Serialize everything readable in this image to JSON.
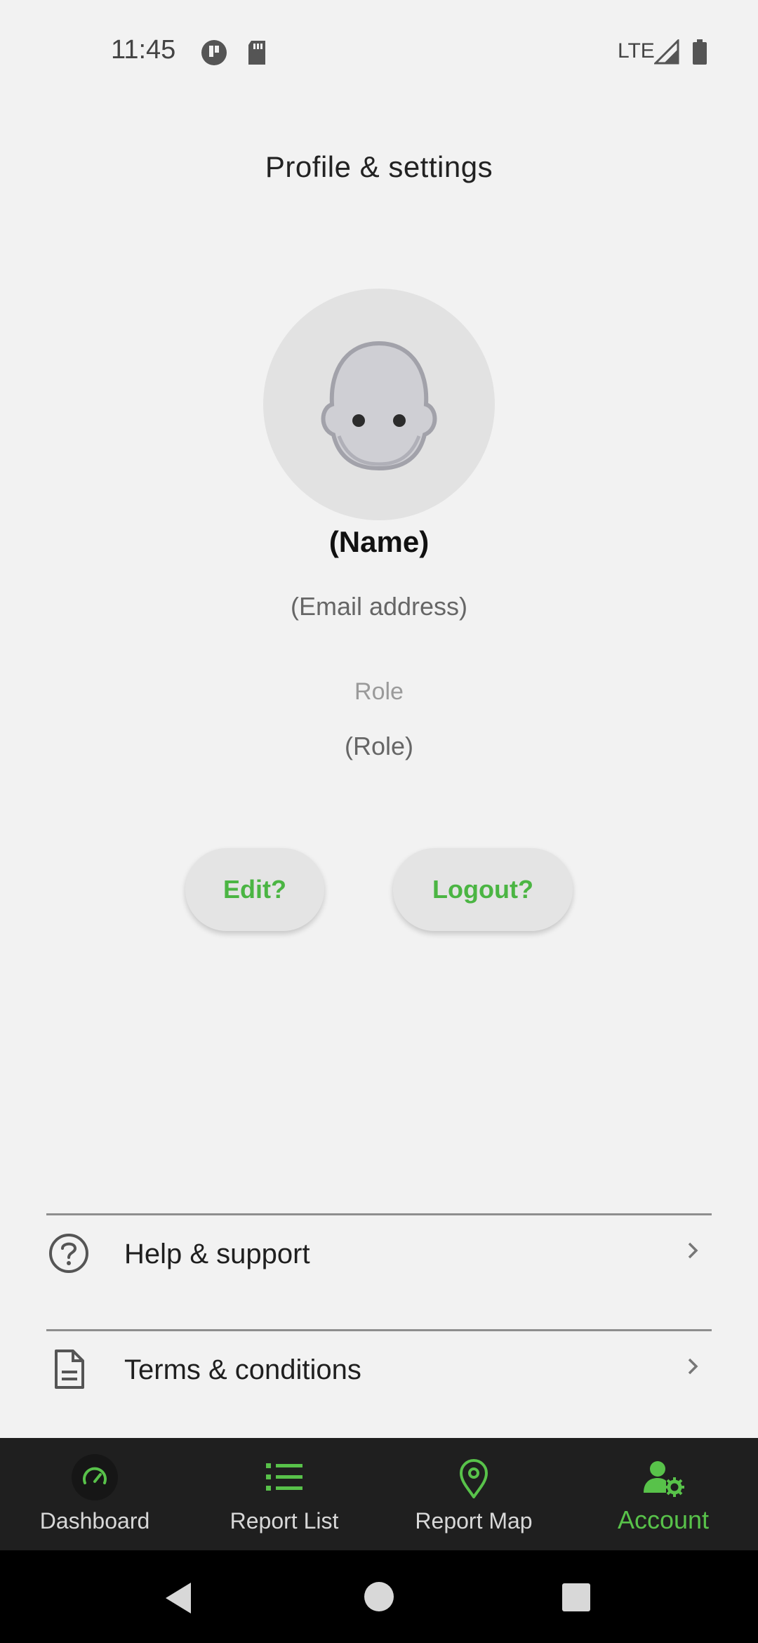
{
  "status_bar": {
    "time": "11:45",
    "network": "LTE"
  },
  "header": {
    "title": "Profile & settings"
  },
  "profile": {
    "name": "(Name)",
    "email": "(Email address)",
    "role_label": "Role",
    "role_value": "(Role)"
  },
  "actions": {
    "edit_label": "Edit?",
    "logout_label": "Logout?"
  },
  "menu": {
    "items": [
      {
        "label": "Help & support",
        "icon": "help-circle-icon"
      },
      {
        "label": "Terms & conditions",
        "icon": "document-icon"
      }
    ]
  },
  "bottom_nav": {
    "items": [
      {
        "label": "Dashboard",
        "icon": "speedometer-icon",
        "active": false
      },
      {
        "label": "Report List",
        "icon": "list-icon",
        "active": false
      },
      {
        "label": "Report Map",
        "icon": "map-pin-icon",
        "active": false
      },
      {
        "label": "Account",
        "icon": "user-gear-icon",
        "active": true
      }
    ]
  },
  "colors": {
    "accent": "#4bb543",
    "nav_background": "#1f1f1f",
    "page_background": "#f2f2f2"
  }
}
